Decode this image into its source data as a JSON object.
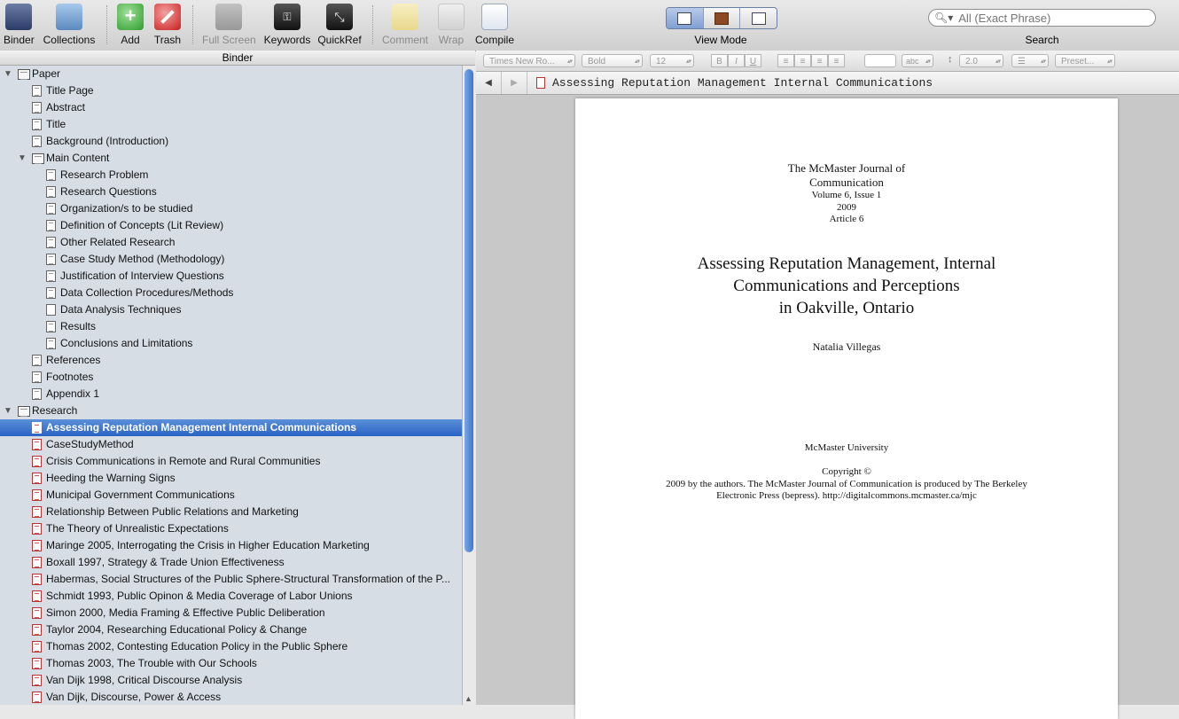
{
  "toolbar": {
    "buttons": [
      {
        "label": "Binder"
      },
      {
        "label": "Collections"
      },
      {
        "label": "Add"
      },
      {
        "label": "Trash"
      },
      {
        "label": "Full Screen"
      },
      {
        "label": "Keywords"
      },
      {
        "label": "QuickRef"
      },
      {
        "label": "Comment"
      },
      {
        "label": "Wrap"
      },
      {
        "label": "Compile"
      }
    ],
    "view_mode_label": "View Mode",
    "search_placeholder": "All (Exact Phrase)",
    "search_label": "Search"
  },
  "binder": {
    "header": "Binder",
    "items": [
      {
        "label": "Paper"
      },
      {
        "label": "Title Page"
      },
      {
        "label": "Abstract"
      },
      {
        "label": "Title"
      },
      {
        "label": "Background (Introduction)"
      },
      {
        "label": "Main Content"
      },
      {
        "label": "Research Problem"
      },
      {
        "label": "Research Questions"
      },
      {
        "label": "Organization/s to be studied"
      },
      {
        "label": "Definition of Concepts (Lit Review)"
      },
      {
        "label": "Other Related Research"
      },
      {
        "label": "Case Study Method (Methodology)"
      },
      {
        "label": "Justification of Interview Questions"
      },
      {
        "label": "Data Collection Procedures/Methods"
      },
      {
        "label": "Data Analysis Techniques"
      },
      {
        "label": "Results"
      },
      {
        "label": "Conclusions and Limitations"
      },
      {
        "label": "References"
      },
      {
        "label": "Footnotes"
      },
      {
        "label": "Appendix 1"
      },
      {
        "label": "Research"
      },
      {
        "label": "Assessing Reputation Management Internal Communications"
      },
      {
        "label": "CaseStudyMethod"
      },
      {
        "label": "Crisis Communications in Remote and Rural Communities"
      },
      {
        "label": "Heeding the Warning Signs"
      },
      {
        "label": "Municipal Government Communications"
      },
      {
        "label": "Relationship Between Public Relations and Marketing"
      },
      {
        "label": "The Theory of Unrealistic Expectations"
      },
      {
        "label": "Maringe 2005, Interrogating the Crisis in Higher Education Marketing"
      },
      {
        "label": "Boxall 1997, Strategy & Trade Union Effectiveness"
      },
      {
        "label": "Habermas, Social Structures of the Public Sphere-Structural Transformation of the P..."
      },
      {
        "label": "Schmidt 1993, Public Opinon & Media Coverage of Labor Unions"
      },
      {
        "label": "Simon 2000, Media Framing & Effective Public Deliberation"
      },
      {
        "label": "Taylor 2004, Researching Educational Policy & Change"
      },
      {
        "label": "Thomas 2002, Contesting Education Policy in the Public Sphere"
      },
      {
        "label": "Thomas 2003, The Trouble with Our Schools"
      },
      {
        "label": "Van Dijk 1998, Critical Discourse Analysis"
      },
      {
        "label": "Van Dijk, Discourse, Power & Access"
      }
    ]
  },
  "format_bar": {
    "font": "Times New Ro...",
    "style": "Bold",
    "size": "12",
    "bold": "B",
    "italic": "I",
    "underline": "U",
    "highlight": "abc",
    "line_spacing": "2.0",
    "preset": "Preset..."
  },
  "editor": {
    "doc_title": "Assessing Reputation Management Internal Communications",
    "journal_line1": "The McMaster Journal of",
    "journal_line2": "Communication",
    "volume": "Volume 6, Issue 1",
    "year": "2009",
    "article": "Article 6",
    "title_line1": "Assessing Reputation Management, Internal",
    "title_line2": "Communications and Perceptions",
    "title_line3": "in Oakville, Ontario",
    "author": "Natalia Villegas",
    "university": "McMaster University",
    "copyright_line1": "Copyright ©",
    "copyright_line2": "2009 by the authors. The McMaster Journal of Communication is produced by The Berkeley",
    "copyright_line3": "Electronic Press (bepress). http://digitalcommons.mcmaster.ca/mjc"
  }
}
